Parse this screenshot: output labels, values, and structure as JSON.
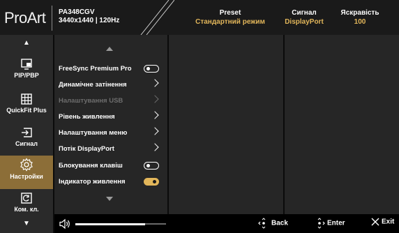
{
  "header": {
    "brand": "ProArt",
    "model": "PA348CGV",
    "resolution": "3440x1440 | 120Hz",
    "preset": {
      "label": "Preset",
      "value": "Стандартний режим"
    },
    "signal": {
      "label": "Сигнал",
      "value": "DisplayPort"
    },
    "brightness": {
      "label": "Яскравість",
      "value": "100"
    }
  },
  "rail": {
    "items": [
      {
        "label": "PIP/PBP",
        "icon": "pip-icon",
        "active": false
      },
      {
        "label": "QuickFit Plus",
        "icon": "grid-icon",
        "active": false
      },
      {
        "label": "Сигнал",
        "icon": "input-icon",
        "active": false
      },
      {
        "label": "Настройки",
        "icon": "gear-icon",
        "active": true
      },
      {
        "label": "Ком. кл.",
        "icon": "shortcut-icon",
        "active": false
      }
    ]
  },
  "menu": {
    "items": [
      {
        "label": "FreeSync Premium Pro",
        "control": "toggle",
        "state": "off",
        "disabled": false
      },
      {
        "label": "Динамічне затінення",
        "control": "chevron",
        "disabled": false
      },
      {
        "label": "Налаштування USB",
        "control": "chevron",
        "disabled": true
      },
      {
        "label": "Рівень живлення",
        "control": "chevron",
        "disabled": false
      },
      {
        "label": "Налаштування меню",
        "control": "chevron",
        "disabled": false
      },
      {
        "label": "Потік DisplayPort",
        "control": "chevron",
        "disabled": false
      },
      {
        "label": "Блокування клавіш",
        "control": "toggle",
        "state": "off",
        "disabled": false
      },
      {
        "label": "Індикатор живлення",
        "control": "toggle",
        "state": "on",
        "disabled": false
      }
    ]
  },
  "footer": {
    "volume_level": 0.77,
    "back_label": "Back",
    "enter_label": "Enter",
    "exit_label": "Exit"
  },
  "colors": {
    "accent": "#e2b65a",
    "active_tab": "#8c6e38"
  }
}
